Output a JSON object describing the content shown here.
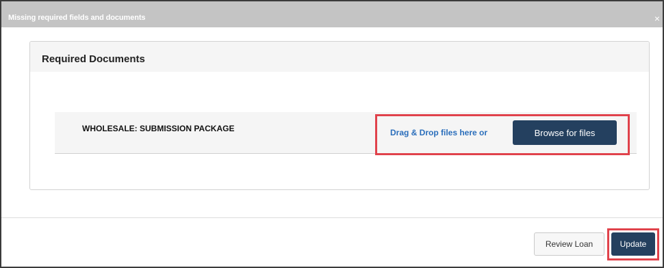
{
  "modal": {
    "title": "Missing required fields and documents",
    "close_icon": "close-icon"
  },
  "panel": {
    "title": "Required Documents",
    "documents": [
      {
        "name": "WHOLESALE: SUBMISSION PACKAGE",
        "drop_text": "Drag & Drop files here or",
        "browse_label": "Browse for files"
      }
    ]
  },
  "footer": {
    "review_label": "Review Loan",
    "update_label": "Update"
  },
  "colors": {
    "header_bg": "#c4c4c4",
    "primary_button": "#24405f",
    "link_text": "#2a6ebb",
    "highlight": "#e0424b"
  }
}
